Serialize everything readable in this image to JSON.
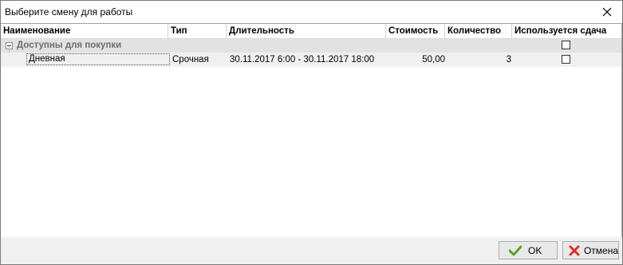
{
  "window": {
    "title": "Выберите смену для работы",
    "close_icon": "close-icon"
  },
  "table": {
    "columns": [
      "Наименование",
      "Тип",
      "Длительность",
      "Стоимость",
      "Количество",
      "Используется сдача"
    ],
    "group": {
      "label": "Доступны для покупки",
      "expanded": true,
      "uses_change_checked": false
    },
    "rows": [
      {
        "name": "Дневная",
        "type": "Срочная",
        "duration": "30.11.2017 6:00 - 30.11.2017 18:00",
        "cost": "50,00",
        "quantity": "3",
        "uses_change_checked": false
      }
    ]
  },
  "footer": {
    "ok_label": "OK",
    "cancel_label": "Отмена"
  },
  "colors": {
    "ok_check": "#5aa02c",
    "cancel_x": "#d9342b",
    "group_bg": "#e2e2e2"
  }
}
